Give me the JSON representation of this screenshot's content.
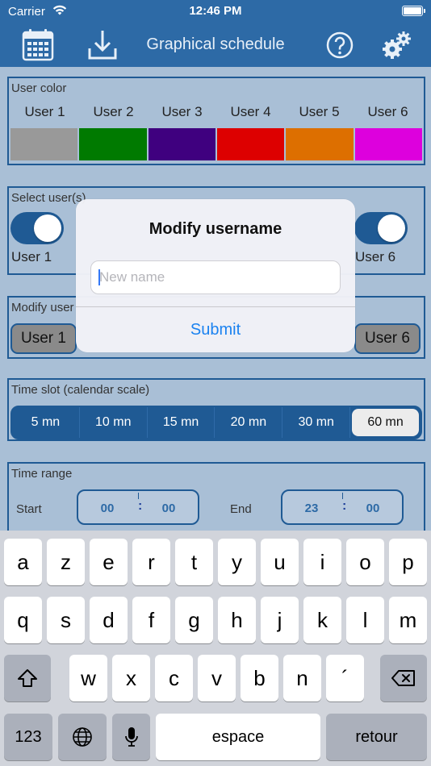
{
  "status_bar": {
    "carrier": "Carrier",
    "time": "12:46 PM"
  },
  "nav": {
    "title": "Graphical schedule",
    "icons": [
      "calendar-icon",
      "download-icon",
      "help-icon",
      "settings-icon"
    ]
  },
  "user_color": {
    "label": "User color",
    "users": [
      {
        "name": "User 1",
        "color": "#999999"
      },
      {
        "name": "User 2",
        "color": "#007a00"
      },
      {
        "name": "User 3",
        "color": "#3f007f"
      },
      {
        "name": "User 4",
        "color": "#dd0000"
      },
      {
        "name": "User 5",
        "color": "#dd6f00"
      },
      {
        "name": "User 6",
        "color": "#dd00dd"
      }
    ]
  },
  "select_users": {
    "label": "Select user(s)",
    "left_user": "User 1",
    "right_user": "User 6"
  },
  "modify_user": {
    "label": "Modify user",
    "left_button": "User 1",
    "right_button": "User 6"
  },
  "time_slot": {
    "label": "Time slot (calendar scale)",
    "options": [
      "5 mn",
      "10 mn",
      "15 mn",
      "20 mn",
      "30 mn",
      "60 mn"
    ],
    "selected": "60 mn"
  },
  "time_range": {
    "label": "Time range",
    "start_label": "Start",
    "start_hour": "00",
    "start_minute": "00",
    "end_label": "End",
    "end_hour": "23",
    "end_minute": "00",
    "separator": ":"
  },
  "dialog": {
    "title": "Modify username",
    "input_placeholder": "New name",
    "input_value": "",
    "button": "Submit"
  },
  "keyboard": {
    "row1": [
      "a",
      "z",
      "e",
      "r",
      "t",
      "y",
      "u",
      "i",
      "o",
      "p"
    ],
    "row2": [
      "q",
      "s",
      "d",
      "f",
      "g",
      "h",
      "j",
      "k",
      "l",
      "m"
    ],
    "row3": [
      "w",
      "x",
      "c",
      "v",
      "b",
      "n",
      "´"
    ],
    "numbers": "123",
    "space": "espace",
    "return": "retour"
  },
  "colors": {
    "accent": "#2d6aa6",
    "border": "#1f5a94",
    "link": "#1a82f0",
    "background": "#a9bfd6"
  }
}
